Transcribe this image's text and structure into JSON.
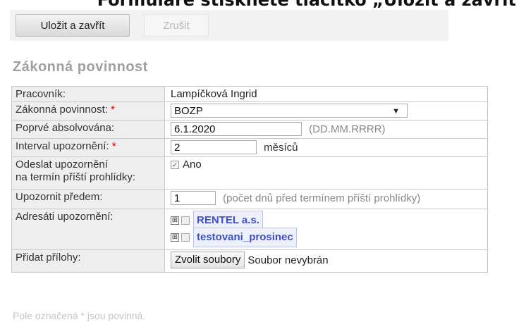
{
  "page_heading": "Formuláře stiskněte tlačítko „Uložit a zavřít",
  "toolbar": {
    "save_label": "Uložit a zavřít",
    "cancel_label": "Zrušit"
  },
  "section_title": "Zákonná povinnost",
  "form": {
    "employee": {
      "label": "Pracovník:",
      "value": "Lampíčková Ingrid"
    },
    "duty": {
      "label": "Zákonná povinnost:",
      "required_mark": "*",
      "value": "BOZP",
      "arrow_icon": "dropdown-arrow-icon"
    },
    "first_completed": {
      "label": "Poprvé absolvována:",
      "value": "6.1.2020",
      "hint": "(DD.MM.RRRR)"
    },
    "interval": {
      "label": "Interval upozornění:",
      "required_mark": "*",
      "value": "2",
      "unit": "měsíců"
    },
    "send_notice": {
      "label_line1": "Odeslat upozornění",
      "label_line2": "na termín příští prohlídky:",
      "checked": true,
      "option": "Ano"
    },
    "notify_ahead": {
      "label": "Upozornit předem:",
      "value": "1",
      "hint": "(počet dnů před termínem příští prohlídky)"
    },
    "recipients": {
      "label": "Adresáti upozornění:",
      "items": [
        {
          "name": "RENTEL a.s.",
          "expander": "⊞"
        },
        {
          "name": "testovani_prosinec",
          "expander": "⊞"
        }
      ]
    },
    "attachments": {
      "label": "Přidat přílohy:",
      "button": "Zvolit soubory",
      "status": "Soubor nevybrán"
    }
  },
  "footer_note": "Pole označená * jsou povinná."
}
